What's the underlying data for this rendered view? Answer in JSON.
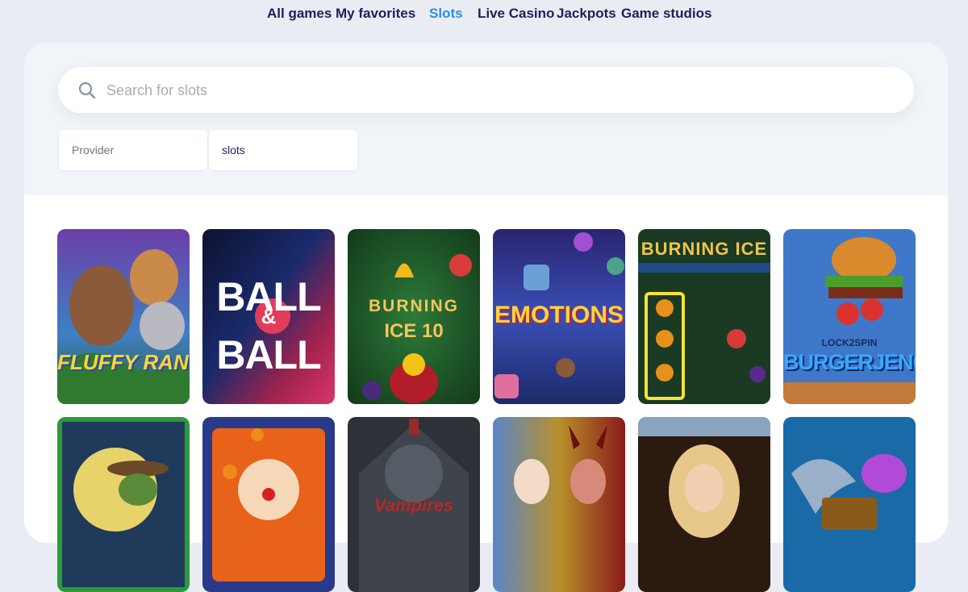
{
  "nav": {
    "items": [
      {
        "label": "All games"
      },
      {
        "label": "My favorites"
      },
      {
        "label": "Slots"
      },
      {
        "label": "Live Casino"
      },
      {
        "label": "Jackpots"
      },
      {
        "label": "Game studios"
      }
    ],
    "active": "Slots"
  },
  "search": {
    "placeholder": "Search for slots",
    "icon": "search-icon"
  },
  "filters": {
    "provider": "Provider",
    "category": "slots"
  },
  "games": [
    {
      "title": "FLUFFY RANGERS"
    },
    {
      "title_1": "BALL",
      "amp": "&",
      "title_2": "BALL"
    },
    {
      "title_1": "BURNING",
      "title_2": "ICE 10"
    },
    {
      "title": "EMOTIONS"
    },
    {
      "title": "BURNING ICE"
    },
    {
      "badge": "LOCK2SPIN",
      "title": "BURGERJENGA"
    },
    {
      "title": ""
    },
    {
      "title": ""
    },
    {
      "title": "Vampires"
    },
    {
      "title": ""
    },
    {
      "title": ""
    },
    {
      "title": ""
    }
  ],
  "colors": {
    "accent": "#2b8ee8",
    "nav_text": "#1e1f5c",
    "page_bg": "#e9edf3"
  }
}
